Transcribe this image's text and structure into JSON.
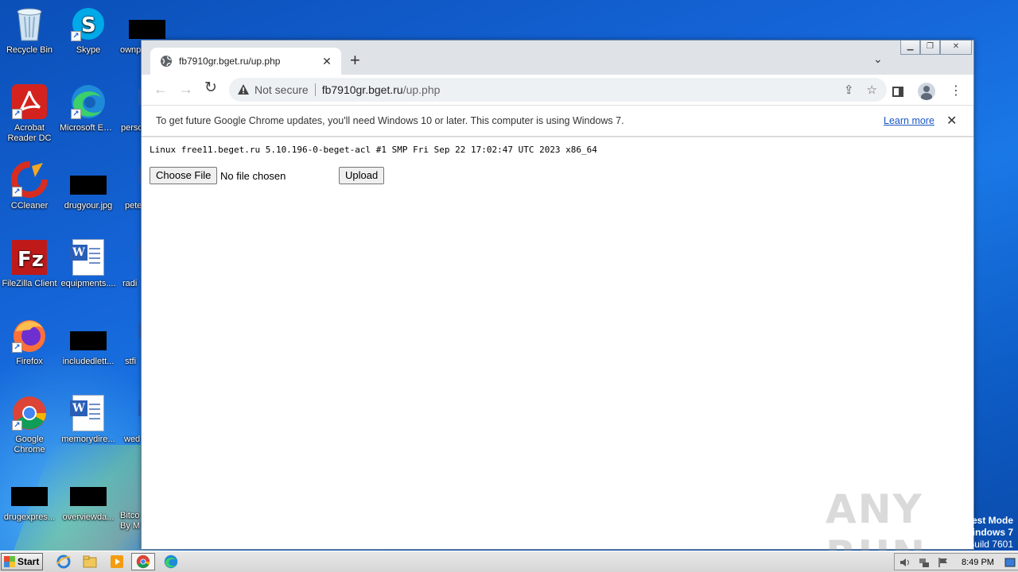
{
  "desktop": {
    "icons": [
      {
        "label": "Recycle Bin",
        "icon": "recycle-bin-icon"
      },
      {
        "label": "Skype",
        "icon": "skype-icon"
      },
      {
        "label": "ownp",
        "icon": "black-image-icon"
      },
      {
        "label": "Acrobat Reader DC",
        "icon": "acrobat-icon"
      },
      {
        "label": "Microsoft Edge",
        "icon": "edge-icon"
      },
      {
        "label": "perso",
        "icon": "word-doc-icon"
      },
      {
        "label": "CCleaner",
        "icon": "ccleaner-icon"
      },
      {
        "label": "drugyour.jpg",
        "icon": "black-image-icon"
      },
      {
        "label": "pete",
        "icon": "word-doc-icon"
      },
      {
        "label": "FileZilla Client",
        "icon": "filezilla-icon"
      },
      {
        "label": "equipments....",
        "icon": "word-doc-icon"
      },
      {
        "label": "radi",
        "icon": "word-doc-icon"
      },
      {
        "label": "Firefox",
        "icon": "firefox-icon"
      },
      {
        "label": "includedlett...",
        "icon": "black-image-icon"
      },
      {
        "label": "stfi",
        "icon": "word-doc-icon"
      },
      {
        "label": "Google Chrome",
        "icon": "chrome-icon"
      },
      {
        "label": "memorydire...",
        "icon": "word-doc-icon"
      },
      {
        "label": "wed",
        "icon": "word-doc-icon"
      },
      {
        "label": "drugexpres...",
        "icon": "black-image-icon"
      },
      {
        "label": "overviewda...",
        "icon": "black-image-icon"
      },
      {
        "label": "Bitco By M",
        "icon": "bitcoin-icon"
      }
    ]
  },
  "browser": {
    "tab_title": "fb7910gr.bget.ru/up.php",
    "omnibox": {
      "security_label": "Not secure",
      "host": "fb7910gr.bget.ru",
      "path": "/up.php"
    },
    "infobar": {
      "message": "To get future Google Chrome updates, you'll need Windows 10 or later. This computer is using Windows 7.",
      "link": "Learn more"
    },
    "page": {
      "uname": "Linux free11.beget.ru 5.10.196-0-beget-acl #1 SMP Fri Sep 22 17:02:47 UTC 2023 x86_64",
      "choose_file_label": "Choose File",
      "no_file_text": "No file chosen",
      "upload_label": "Upload"
    }
  },
  "watermark": "ANY RUN",
  "test_mode": {
    "line1": "est Mode",
    "line2": "indows 7",
    "line3": "Build 7601"
  },
  "taskbar": {
    "start_label": "Start",
    "clock": "8:49 PM"
  }
}
